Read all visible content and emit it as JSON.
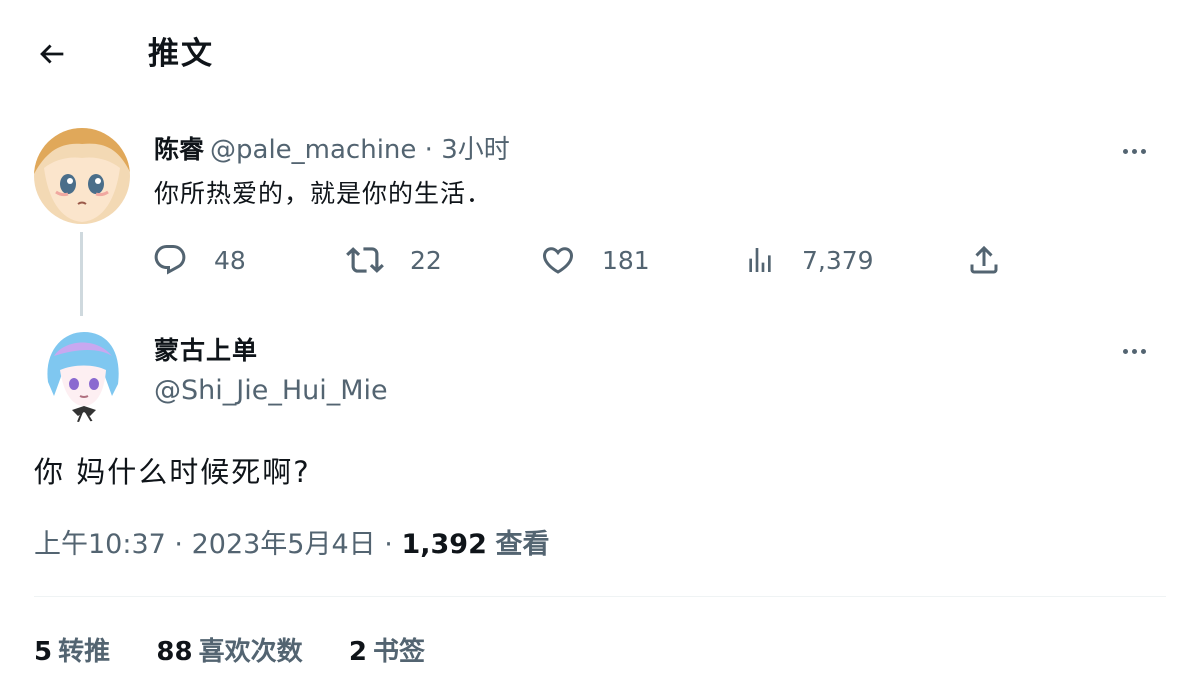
{
  "header": {
    "title": "推文"
  },
  "icons": {
    "back": "arrow-left-icon",
    "reply": "comment-bubble-icon",
    "retweet": "retweet-icon",
    "like": "heart-icon",
    "views": "bar-chart-icon",
    "share": "share-upload-icon",
    "more": "more-horizontal-icon"
  },
  "colors": {
    "text": "#0f1419",
    "muted": "#536471",
    "thread_line": "#cfd9de",
    "divider": "#eff3f4"
  },
  "parent_tweet": {
    "display_name": "陈睿",
    "handle": "@pale_machine",
    "separator": "·",
    "time": "3小时",
    "text": "你所热爱的，就是你的生活．",
    "replies": "48",
    "retweets": "22",
    "likes": "181",
    "views": "7,379"
  },
  "reply_tweet": {
    "display_name": "蒙古上单",
    "handle": "@Shi_Jie_Hui_Mie",
    "text": "你 妈什么时候死啊?",
    "time": "上午10:37",
    "sep1": "·",
    "date": "2023年5月4日",
    "sep2": "·",
    "views_count": "1,392",
    "views_label": "查看"
  },
  "stats": [
    {
      "count": "5",
      "label": "转推"
    },
    {
      "count": "88",
      "label": "喜欢次数"
    },
    {
      "count": "2",
      "label": "书签"
    }
  ]
}
